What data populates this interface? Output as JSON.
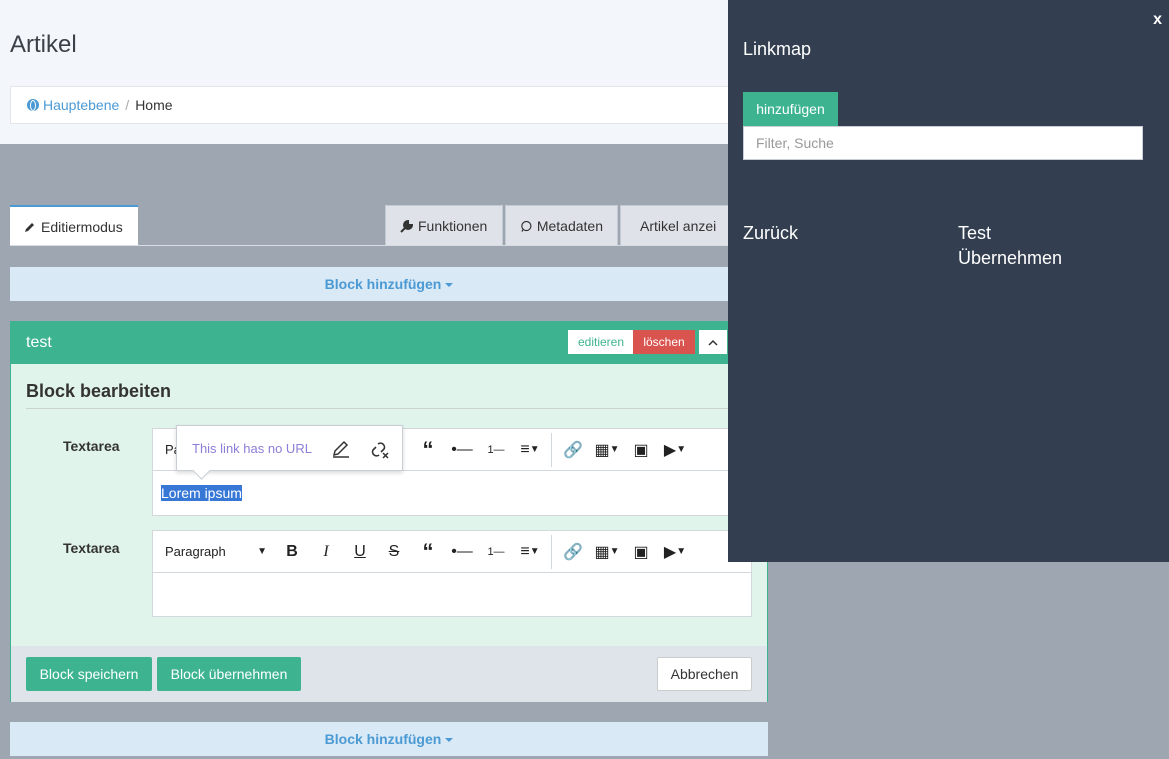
{
  "header": {
    "title": "Artikel",
    "breadcrumb": {
      "root": "Hauptebene",
      "separator": "/",
      "current": "Home"
    }
  },
  "tabs": {
    "edit": "Editiermodus",
    "functions": "Funktionen",
    "metadata": "Metadaten",
    "view": "Artikel anzei"
  },
  "add_block_label": "Block hinzufügen",
  "block": {
    "name": "test",
    "edit_label": "editieren",
    "delete_label": "löschen",
    "up_label": "^",
    "heading": "Block bearbeiten",
    "fields": [
      {
        "label": "Textarea",
        "format": "Paragraph",
        "content": "Lorem ipsum"
      },
      {
        "label": "Textarea",
        "format": "Paragraph",
        "content": ""
      }
    ],
    "link_tooltip": "This link has no URL",
    "save_label": "Block speichern",
    "apply_label": "Block übernehmen",
    "cancel_label": "Abbrechen"
  },
  "linkmap": {
    "close_label": "x",
    "title": "Linkmap",
    "add_label": "hinzufügen",
    "filter_placeholder": "Filter, Suche",
    "back_label": "Zurück",
    "items": [
      "Test",
      "Übernehmen"
    ]
  },
  "colors": {
    "accent_green": "#3db48f",
    "danger": "#d9534f",
    "link_blue": "#4b9ad4",
    "panel_dark": "#333f50"
  }
}
